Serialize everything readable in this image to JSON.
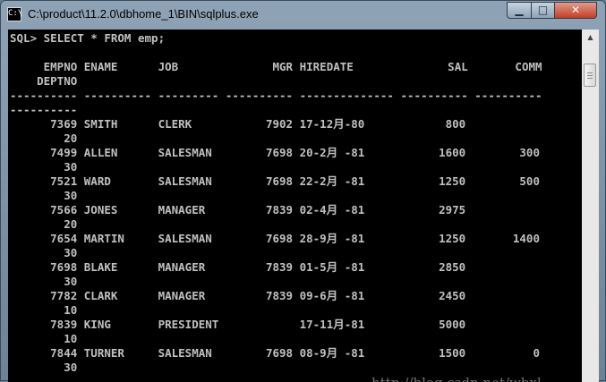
{
  "window": {
    "title": "C:\\product\\11.2.0\\dbhome_1\\BIN\\sqlplus.exe",
    "icon_glyph": "C:\\",
    "buttons": {
      "minimize": "▁",
      "maximize": "□",
      "close": "✕"
    }
  },
  "console": {
    "lines": [
      "SQL> SELECT * FROM emp;",
      "",
      "     EMPNO ENAME      JOB              MGR HIREDATE              SAL       COMM",
      "    DEPTNO",
      "---------- ---------- --------- ---------- -------------- ---------- ----------",
      "----------",
      "      7369 SMITH      CLERK           7902 17-12月-80            800",
      "        20",
      "      7499 ALLEN      SALESMAN        7698 20-2月 -81           1600        300",
      "        30",
      "      7521 WARD       SALESMAN        7698 22-2月 -81           1250        500",
      "        30",
      "      7566 JONES      MANAGER         7839 02-4月 -81           2975",
      "        20",
      "      7654 MARTIN     SALESMAN        7698 28-9月 -81           1250       1400",
      "        30",
      "      7698 BLAKE      MANAGER         7839 01-5月 -81           2850",
      "        30",
      "      7782 CLARK      MANAGER         7839 09-6月 -81           2450",
      "        10",
      "      7839 KING       PRESIDENT            17-11月-81           5000",
      "        10",
      "      7844 TURNER     SALESMAN        7698 08-9月 -81           1500          0",
      "        30"
    ],
    "watermark": "http://blog.csdn.net/wbxl"
  },
  "scrollbar": {
    "up_arrow": "▲"
  },
  "colors": {
    "console_bg": "#000000",
    "console_fg": "#c0c0c0",
    "close_button": "#c33f25"
  }
}
